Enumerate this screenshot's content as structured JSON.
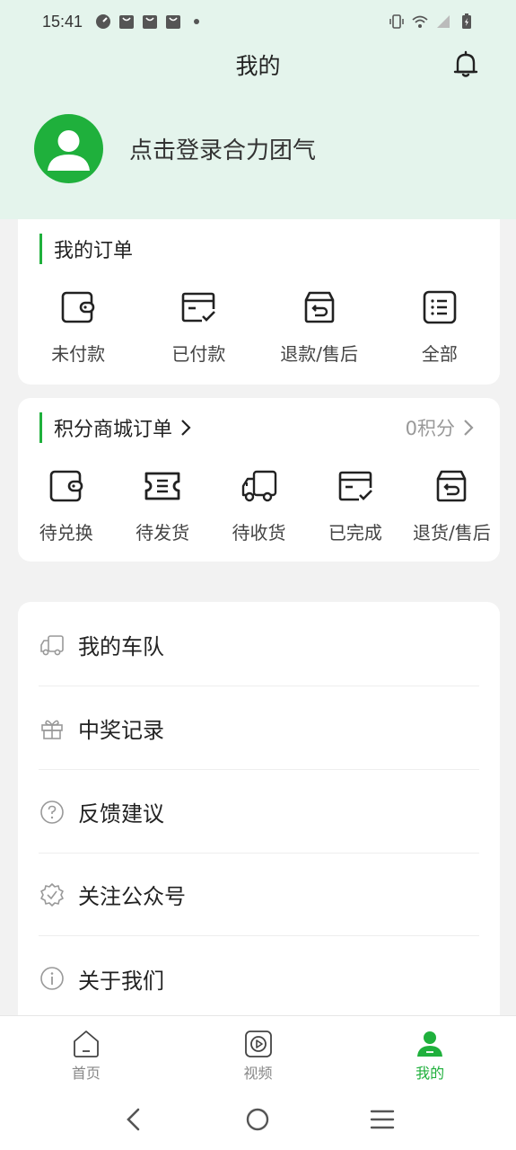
{
  "status_bar": {
    "time": "15:41"
  },
  "header": {
    "title": "我的"
  },
  "profile": {
    "login_text": "点击登录合力团气"
  },
  "orders": {
    "title": "我的订单",
    "items": [
      {
        "label": "未付款",
        "icon": "wallet-icon"
      },
      {
        "label": "已付款",
        "icon": "card-check-icon"
      },
      {
        "label": "退款/售后",
        "icon": "return-box-icon"
      },
      {
        "label": "全部",
        "icon": "list-icon"
      }
    ]
  },
  "points": {
    "title": "积分商城订单",
    "points_text": "0积分",
    "items": [
      {
        "label": "待兑换",
        "icon": "wallet-icon"
      },
      {
        "label": "待发货",
        "icon": "ticket-icon"
      },
      {
        "label": "待收货",
        "icon": "truck-icon"
      },
      {
        "label": "已完成",
        "icon": "card-check-icon"
      },
      {
        "label": "退货/售后",
        "icon": "return-box-icon"
      }
    ]
  },
  "menu": [
    {
      "label": "我的车队",
      "icon": "truck-icon"
    },
    {
      "label": "中奖记录",
      "icon": "gift-icon"
    },
    {
      "label": "反馈建议",
      "icon": "question-icon"
    },
    {
      "label": "关注公众号",
      "icon": "badge-check-icon"
    },
    {
      "label": "关于我们",
      "icon": "info-icon"
    }
  ],
  "tabs": [
    {
      "label": "首页",
      "icon": "home-icon",
      "active": false
    },
    {
      "label": "视频",
      "icon": "video-icon",
      "active": false
    },
    {
      "label": "我的",
      "icon": "user-icon",
      "active": true
    }
  ],
  "colors": {
    "accent": "#1fb03c",
    "header_bg": "#e4f4ec"
  }
}
